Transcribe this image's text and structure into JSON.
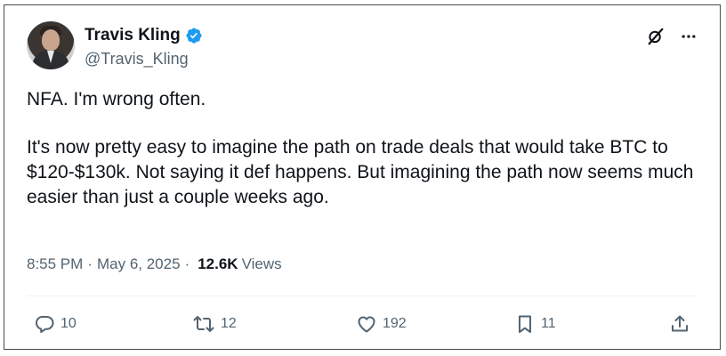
{
  "author": {
    "display_name": "Travis Kling",
    "handle": "@Travis_Kling",
    "verified": true
  },
  "tweet": {
    "paragraphs": [
      "NFA. I'm wrong often.",
      "It's now pretty easy to imagine the path on trade deals that would take BTC to $120-$130k. Not saying it def happens. But imagining the path now seems much easier than just a couple weeks ago."
    ]
  },
  "meta": {
    "time": "8:55 PM",
    "separator": "·",
    "date": "May 6, 2025",
    "views_count": "12.6K",
    "views_label": "Views"
  },
  "actions": {
    "replies": "10",
    "reposts": "12",
    "likes": "192",
    "bookmarks": "11"
  },
  "icons": {
    "verified": "verified-badge-icon",
    "grok": "grok-icon",
    "more": "more-icon",
    "reply": "reply-icon",
    "repost": "repost-icon",
    "like": "like-icon",
    "bookmark": "bookmark-icon",
    "share": "share-icon"
  },
  "colors": {
    "verified_blue": "#1d9bf0",
    "text": "#0f1419",
    "secondary": "#536471"
  }
}
